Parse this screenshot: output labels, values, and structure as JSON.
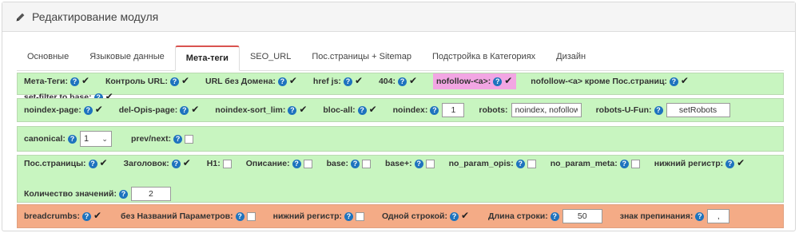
{
  "header": {
    "title": "Редактирование модуля"
  },
  "tabs": [
    {
      "label": "Основные"
    },
    {
      "label": "Языковые данные"
    },
    {
      "label": "Мета-теги"
    },
    {
      "label": "SEO_URL"
    },
    {
      "label": "Пос.страницы + Sitemap"
    },
    {
      "label": "Подстройка в Категориях"
    },
    {
      "label": "Дизайн"
    }
  ],
  "row1": {
    "meta_tags": "Мета-Теги:",
    "url_control": "Контроль URL:",
    "url_no_domain": "URL без Домена:",
    "href_js": "href js:",
    "e404": "404:",
    "nofollow_a": "nofollow-<a>:",
    "nofollow_a_except": "nofollow-<a> кроме Пос.страниц:",
    "set_filter": "set-filter to base:"
  },
  "row2": {
    "noindex_page": "noindex-page:",
    "del_opis_page": "del-Opis-page:",
    "noindex_sort_lim": "noindex-sort_lim:",
    "bloc_all": "bloc-all:",
    "noindex": "noindex:",
    "noindex_value": "1",
    "robots": "robots:",
    "robots_value": "noindex, nofollow",
    "robots_u_fun": "robots-U-Fun:",
    "robots_u_fun_value": "setRobots"
  },
  "row3": {
    "canonical": "canonical:",
    "canonical_value": "1",
    "prev_next": "prev/next:"
  },
  "row4": {
    "pos_pages": "Пос.страницы:",
    "heading": "Заголовок:",
    "h1": "H1:",
    "description": "Описание:",
    "base": "base:",
    "base_plus": "base+:",
    "no_param_opis": "no_param_opis:",
    "no_param_meta": "no_param_meta:",
    "lower_case": "нижний регистр:",
    "value_count": "Количество значений:",
    "value_count_value": "2"
  },
  "row5": {
    "breadcrumbs": "breadcrumbs:",
    "no_param_names": "без Названий Параметров:",
    "lower_case": "нижний регистр:",
    "one_line": "Одной строкой:",
    "line_length": "Длина строки:",
    "line_length_value": "50",
    "punctuation": "знак препинания:",
    "punctuation_value": ","
  },
  "colors": {
    "green_row": "#c8f5c0",
    "orange_row": "#f4ab86",
    "highlight": "#f2a6e3",
    "active_tab_accent": "#d9534f",
    "help_icon": "#1e73be"
  }
}
